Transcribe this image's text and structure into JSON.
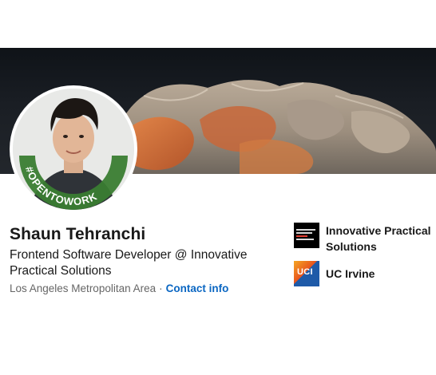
{
  "profile": {
    "name": "Shaun Tehranchi",
    "headline": "Frontend Software Developer @ Innovative Practical Solutions",
    "location": "Los Angeles Metropolitan Area",
    "separator": "·",
    "contact_link": "Contact info",
    "open_to_work_badge": "#OPENTOWORK"
  },
  "experience": [
    {
      "label": "Innovative Practical Solutions",
      "logo": "ips-logo"
    },
    {
      "label": "UC Irvine",
      "logo": "uci-logo",
      "logo_text": "UCI"
    }
  ],
  "colors": {
    "link": "#0a66c2",
    "open_to_work_green": "#3a7d32",
    "text_primary": "#191919",
    "text_secondary": "#666666"
  }
}
